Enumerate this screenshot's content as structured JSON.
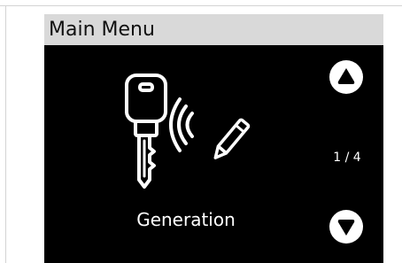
{
  "header": {
    "title": "Main Menu"
  },
  "menu": {
    "item_label": "Generation",
    "item_icon": "key-generation-icon",
    "current_page": 1,
    "total_pages": 4,
    "page_indicator": "1 / 4"
  },
  "nav": {
    "up_icon": "arrow-up-circle-icon",
    "down_icon": "arrow-down-circle-icon"
  },
  "colors": {
    "title_bar_bg": "#d9d9d9",
    "screen_bg": "#000000",
    "foreground": "#ffffff"
  }
}
